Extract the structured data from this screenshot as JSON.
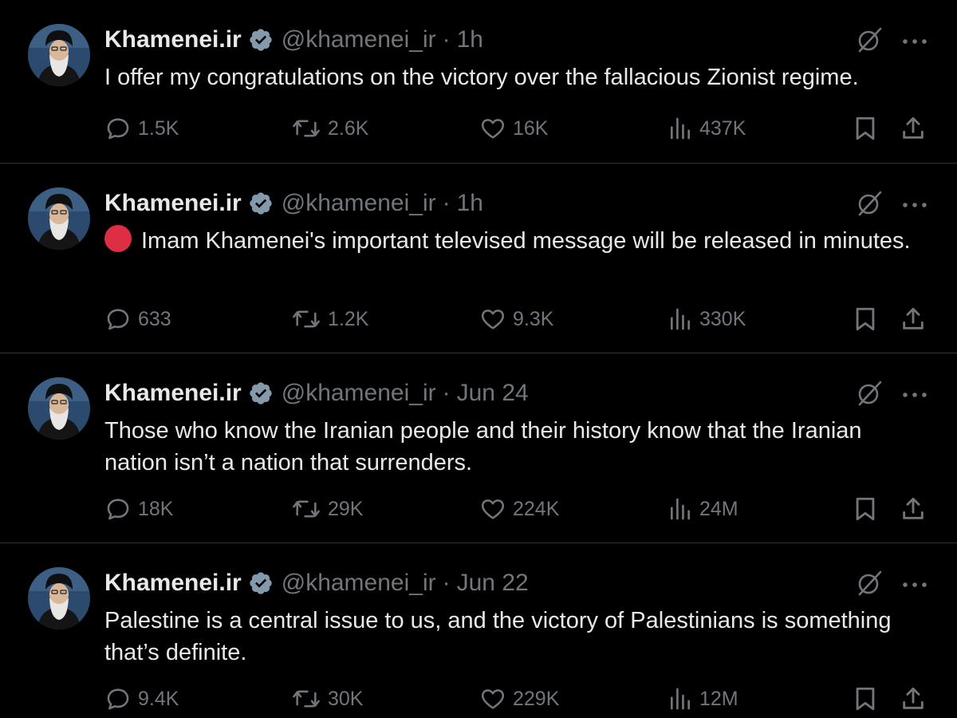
{
  "colors": {
    "background": "#000000",
    "text_primary": "#e7e9ea",
    "text_secondary": "#71767b",
    "verified_badge": "#829aab",
    "live_dot": "#dd2e44",
    "divider": "#2f3336"
  },
  "icons": {
    "reply": "speech-bubble-icon",
    "retweet": "repost-arrows-icon",
    "like": "heart-icon",
    "views": "bar-chart-icon",
    "bookmark": "bookmark-icon",
    "share": "upload-share-icon",
    "grok": "grok-slash-icon",
    "more": "ellipsis-icon",
    "verified": "verified-badge-icon"
  },
  "tweets": [
    {
      "author": {
        "name": "Khamenei.ir",
        "handle": "@khamenei_ir",
        "verified": true
      },
      "separator": "·",
      "time": "1h",
      "text": "I offer my congratulations on the victory over the fallacious Zionist regime.",
      "live_indicator": false,
      "stats": {
        "replies": "1.5K",
        "reposts": "2.6K",
        "likes": "16K",
        "views": "437K"
      }
    },
    {
      "author": {
        "name": "Khamenei.ir",
        "handle": "@khamenei_ir",
        "verified": true
      },
      "separator": "·",
      "time": "1h",
      "text": "Imam Khamenei's important televised message will be released in minutes.",
      "live_indicator": true,
      "stats": {
        "replies": "633",
        "reposts": "1.2K",
        "likes": "9.3K",
        "views": "330K"
      }
    },
    {
      "author": {
        "name": "Khamenei.ir",
        "handle": "@khamenei_ir",
        "verified": true
      },
      "separator": "·",
      "time": "Jun 24",
      "text": "Those who know the Iranian people and their history know that the Iranian nation isn’t a nation that surrenders.",
      "live_indicator": false,
      "stats": {
        "replies": "18K",
        "reposts": "29K",
        "likes": "224K",
        "views": "24M"
      }
    },
    {
      "author": {
        "name": "Khamenei.ir",
        "handle": "@khamenei_ir",
        "verified": true
      },
      "separator": "·",
      "time": "Jun 22",
      "text": "Palestine is a central issue to us, and the victory of Palestinians is something that’s definite.",
      "live_indicator": false,
      "stats": {
        "replies": "9.4K",
        "reposts": "30K",
        "likes": "229K",
        "views": "12M"
      }
    }
  ]
}
